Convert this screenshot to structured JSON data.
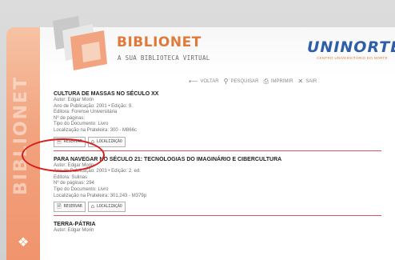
{
  "app": {
    "brand_title": "BIBLIONET",
    "brand_subtitle": "A SUA BIBLIOTECA VIRTUAL",
    "sidebar_word": "BIBLIONET",
    "uni_logo": "UNINORTE",
    "uni_caption": "CENTRO UNIVERSITÁRIO DO NORTE"
  },
  "nav": [
    {
      "label": "VOLTAR",
      "icon": "back-arrow-icon",
      "glyph": "⟵"
    },
    {
      "label": "PESQUISAR",
      "icon": "search-icon",
      "glyph": "⚲"
    },
    {
      "label": "IMPRIMIR",
      "icon": "print-icon",
      "glyph": "⎙"
    },
    {
      "label": "SAIR",
      "icon": "close-icon",
      "glyph": "✕"
    }
  ],
  "records": [
    {
      "title": "CULTURA DE MASSAS NO SÉCULO XX",
      "author": "Autor: Edgar Morin",
      "publication": "Ano de Publicação: 2001 • Edição: 9.",
      "publisher": "Editora: Forense Universitária",
      "pages": "Nº de páginas:",
      "doc_type": "Tipo do Documento: Livro",
      "location": "Localização na Prateleira: 300 - M866c"
    },
    {
      "title": "PARA NAVEGAR NO SÉCULO 21: TECNOLOGIAS DO IMAGINÁRIO E CIBERCULTURA",
      "author": "Autor: Edgar Morin",
      "publication": "Ano de Publicação: 2003 • Edição: 2. ed.",
      "publisher": "Editora: Sulinas",
      "pages": "Nº de páginas: 294",
      "doc_type": "Tipo do Documento: Livro",
      "location": "Localização na Prateleira: 301.243 - M379p"
    },
    {
      "title": "TERRA-PÁTRIA",
      "author": "Autor: Edgar Morin"
    }
  ],
  "buttons": {
    "reserve": "RESERVAR",
    "locate": "LOCALIZAÇÃO"
  },
  "colors": {
    "accent_orange": "#e07a3a",
    "brand_blue": "#2f5ea8",
    "sidebar": "#f2a37f",
    "divider": "#d35a5a",
    "highlight_ring": "#d91d1d"
  }
}
